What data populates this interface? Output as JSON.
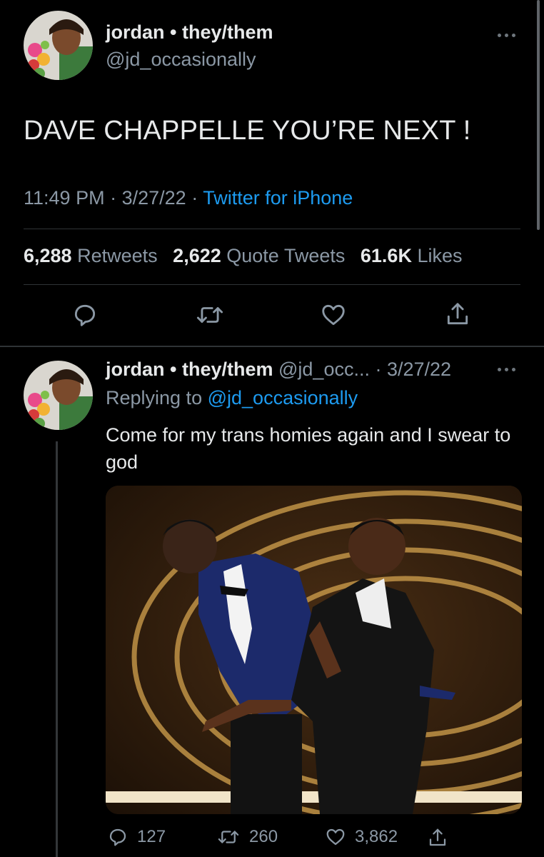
{
  "main_tweet": {
    "display_name": "jordan • they/them",
    "handle": "@jd_occasionally",
    "text": "DAVE CHAPPELLE YOU’RE NEXT !",
    "time": "11:49 PM",
    "date": "3/27/22",
    "source": "Twitter for iPhone",
    "stats": {
      "retweets_count": "6,288",
      "retweets_label": "Retweets",
      "quotes_count": "2,622",
      "quotes_label": "Quote Tweets",
      "likes_count": "61.6K",
      "likes_label": "Likes"
    },
    "actions": [
      "reply-icon",
      "retweet-icon",
      "heart-icon",
      "share-icon"
    ]
  },
  "reply_tweet": {
    "display_name": "jordan • they/them",
    "handle_truncated": "@jd_occ...",
    "date": "3/27/22",
    "replying_prefix": "Replying to",
    "replying_to": "@jd_occasionally",
    "text": "Come for my trans homies again and I swear to god",
    "photo_alt": "photo",
    "reply_count": "127",
    "retweet_count": "260",
    "like_count": "3,862"
  },
  "colors": {
    "background": "#000000",
    "text": "#e7e9ea",
    "secondary": "#8b98a5",
    "link": "#1d9bf0",
    "divider": "#2f3336"
  }
}
